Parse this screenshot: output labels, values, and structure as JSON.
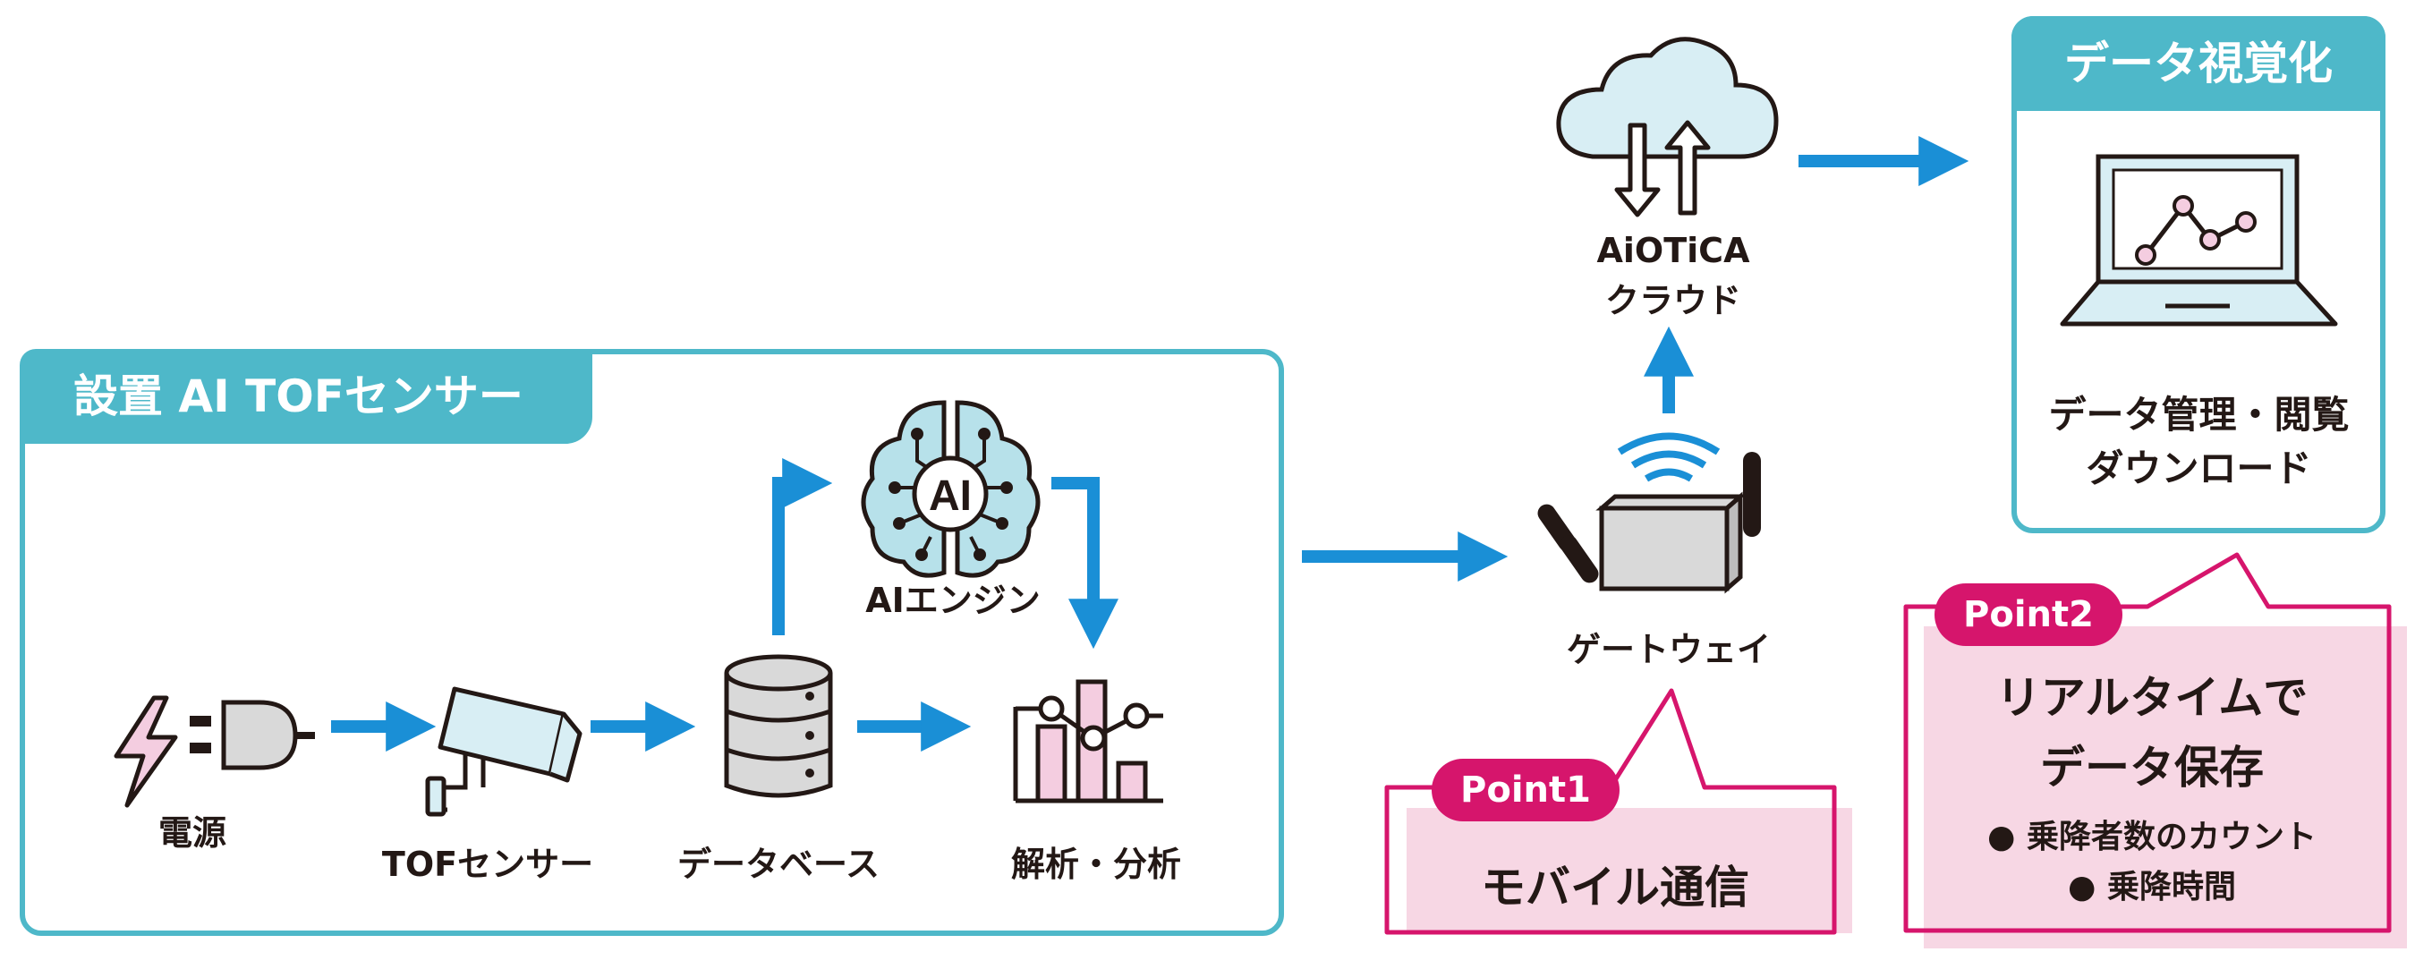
{
  "sensor": {
    "title": "設置 AI TOFセンサー",
    "power_label": "電源",
    "tof_label": "TOFセンサー",
    "database_label": "データベース",
    "ai_engine_label": "AIエンジン",
    "ai_badge": "AI",
    "analysis_label": "解析・分析"
  },
  "gateway": {
    "label": "ゲートウェイ"
  },
  "cloud": {
    "name": "AiOTiCA",
    "label": "クラウド"
  },
  "visualization": {
    "title": "データ視覚化",
    "line1": "データ管理・閲覧",
    "line2": "ダウンロード"
  },
  "point1": {
    "tag": "Point1",
    "text": "モバイル通信"
  },
  "point2": {
    "tag": "Point2",
    "line1": "リアルタイムで",
    "line2": "データ保存",
    "bullet1": "● 乗降者数のカウント",
    "bullet2": "● 乗降時間"
  },
  "colors": {
    "teal": "#4eb8c9",
    "arrow_blue": "#1a8fd6",
    "magenta": "#d6156c",
    "pink_fill": "#f7d7e4",
    "light_blue_fill": "#d8eef4",
    "ink": "#231815"
  }
}
